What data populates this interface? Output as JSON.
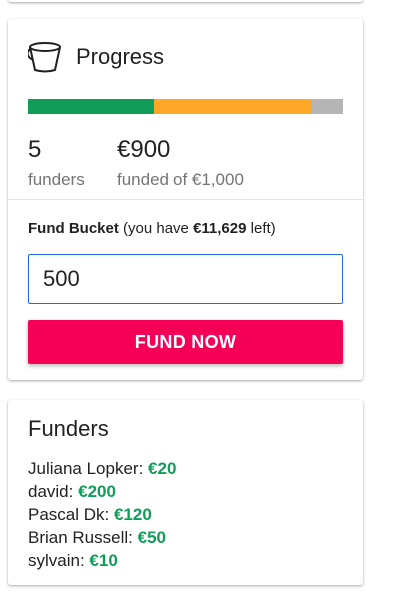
{
  "progress": {
    "title": "Progress",
    "icon": "bucket-icon",
    "bar": {
      "segments": [
        {
          "fraction": 0.4,
          "color": "#0f9d58"
        },
        {
          "fraction": 0.5,
          "color": "#ffa726"
        }
      ],
      "remaining_color": "#b5b5b5"
    },
    "funders_count": "5",
    "funders_label": "funders",
    "funded_amount": "€900",
    "funded_label": "funded",
    "funded_of": "of €1,000"
  },
  "fund": {
    "label": "Fund Bucket",
    "you_have_prefix": "(you have",
    "balance": "€11,629",
    "you_have_suffix": "left)",
    "input_value": "500",
    "button_label": "FUND NOW"
  },
  "funders": {
    "title": "Funders",
    "list": [
      {
        "name": "Juliana Lopker:",
        "amount": "€20"
      },
      {
        "name": "david:",
        "amount": "€200"
      },
      {
        "name": "Pascal Dk:",
        "amount": "€120"
      },
      {
        "name": "Brian Russell:",
        "amount": "€50"
      },
      {
        "name": "sylvain:",
        "amount": "€10"
      }
    ]
  },
  "colors": {
    "accent": "#f50057",
    "success": "#0f9d58",
    "warning": "#ffa726",
    "input_border": "#1e6dd9"
  }
}
